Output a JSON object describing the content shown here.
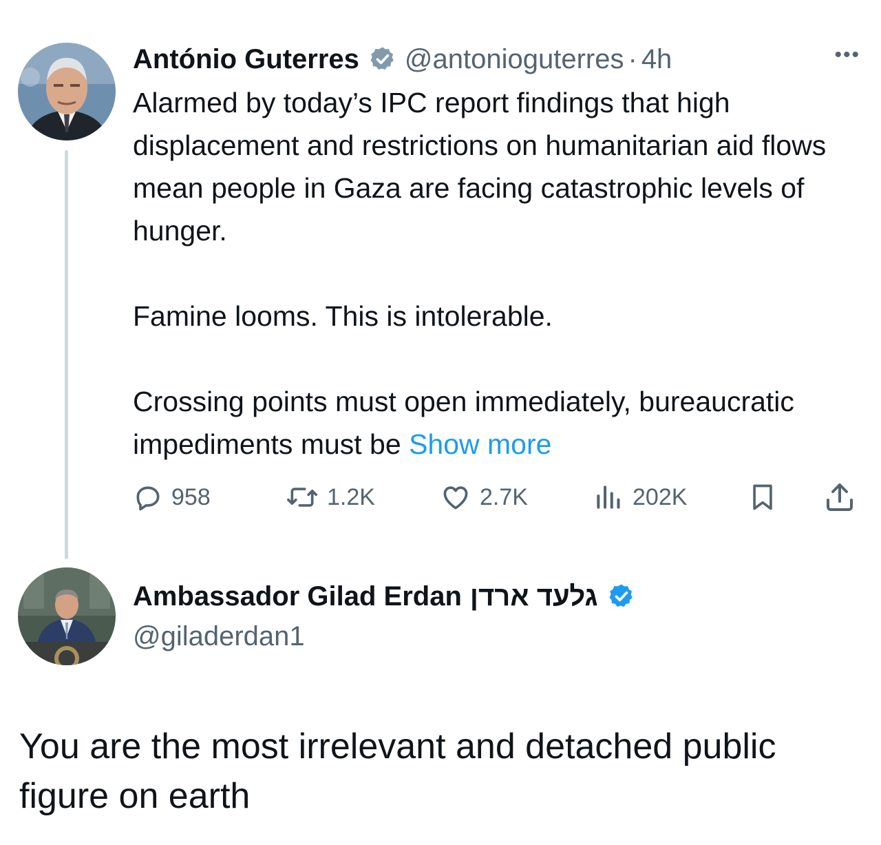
{
  "tweet": {
    "author_name": "António Guterres",
    "author_handle": "@antonioguterres",
    "time": "4h",
    "paragraphs": [
      "Alarmed by today’s IPC report findings that high displacement and restrictions on humanitarian aid flows mean people in Gaza are facing catastrophic levels of hunger.",
      "Famine looms. This is intolerable.",
      "Crossing points must open immediately, bureaucratic impediments must be"
    ],
    "show_more": "Show more",
    "stats": {
      "replies": "958",
      "retweets": "1.2K",
      "likes": "2.7K",
      "views": "202K"
    }
  },
  "reply": {
    "author_name": "Ambassador Gilad Erdan",
    "author_name_hebrew": "גלעד ארדן",
    "author_handle": "@giladerdan1",
    "text": "You are the most irrelevant and detached public figure on earth"
  },
  "colors": {
    "text": "#0f1419",
    "muted": "#536471",
    "link": "#1d9bf0",
    "verified_blue": "#1d9bf0",
    "verified_gray": "#829aab",
    "thread_line": "#cfd9de"
  },
  "icons": [
    "more-icon",
    "verified-gray-icon",
    "verified-blue-icon",
    "reply-icon",
    "retweet-icon",
    "like-icon",
    "views-icon",
    "bookmark-icon",
    "share-icon"
  ]
}
